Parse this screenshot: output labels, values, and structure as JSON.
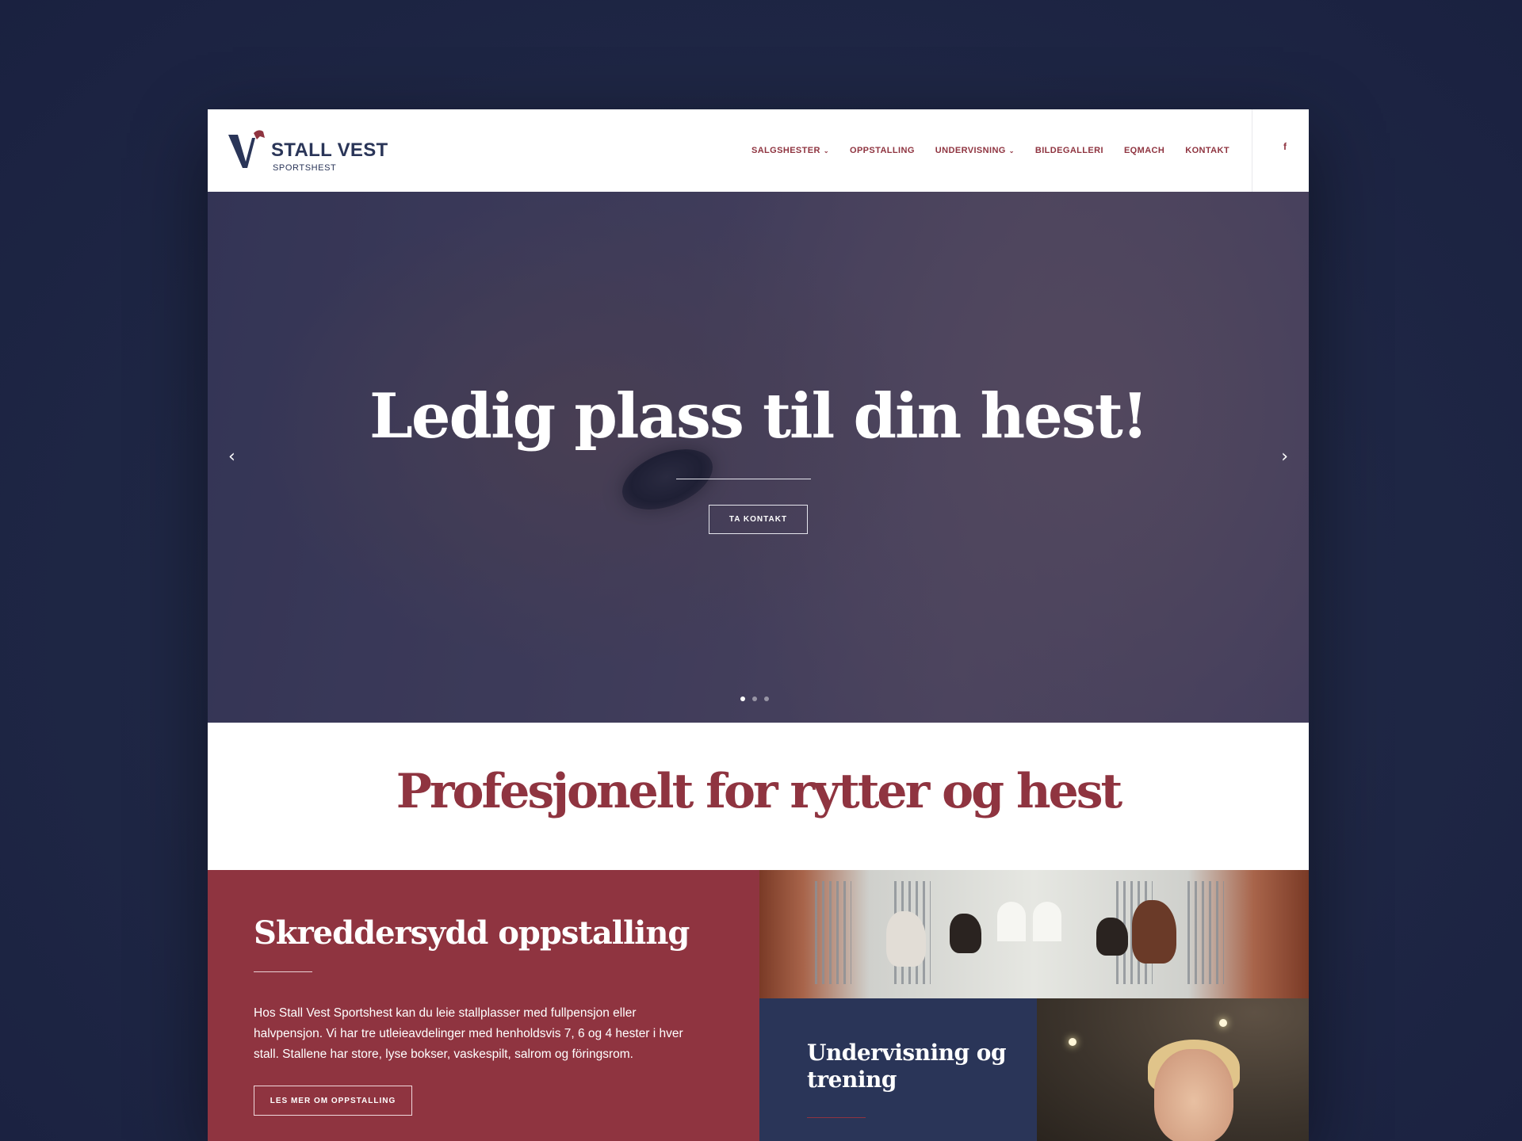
{
  "brand": {
    "name": "STALL VEST",
    "tagline": "SPORTSHEST",
    "colors": {
      "maroon": "#8f3440",
      "navy": "#2a3558",
      "background": "#1f2745"
    }
  },
  "nav": {
    "items": [
      {
        "label": "SALGSHESTER",
        "has_dropdown": true
      },
      {
        "label": "OPPSTALLING",
        "has_dropdown": false
      },
      {
        "label": "UNDERVISNING",
        "has_dropdown": true
      },
      {
        "label": "BILDEGALLERI",
        "has_dropdown": false
      },
      {
        "label": "EQMACH",
        "has_dropdown": false
      },
      {
        "label": "KONTAKT",
        "has_dropdown": false
      }
    ],
    "chevron": "⌄",
    "social_icon": "facebook-icon",
    "social_glyph": "f"
  },
  "hero": {
    "title": "Ledig plass til din hest!",
    "button": "TA KONTAKT",
    "prev_glyph": "‹",
    "next_glyph": "›",
    "slides_count": 3,
    "active_slide": 1
  },
  "intro": {
    "title": "Profesjonelt for rytter og hest"
  },
  "card_oppstalling": {
    "title": "Skreddersydd oppstalling",
    "text": "Hos Stall Vest Sportshest kan du leie stallplasser med fullpensjon eller halvpensjon. Vi har tre utleieavdelinger med henholdsvis 7, 6 og 4 hester i hver stall. Stallene har store, lyse bokser, vaskespilt, salrom og föringsrom.",
    "button": "LES MER OM OPPSTALLING"
  },
  "card_undervisning": {
    "title": "Undervisning og trening"
  }
}
